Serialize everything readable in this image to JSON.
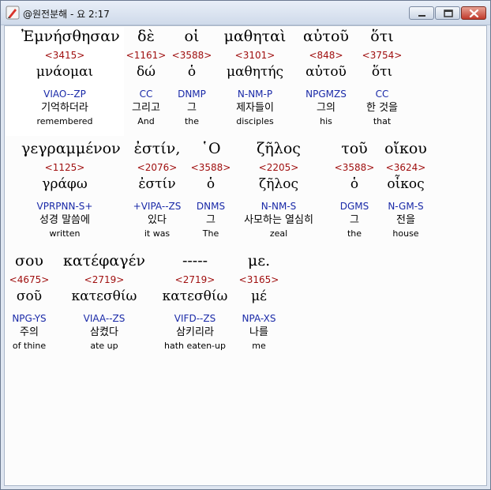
{
  "window": {
    "title": "@원전분해 - 요 2:17"
  },
  "words": [
    {
      "greek": "Ἐμνήσθησαν",
      "strong": "<3415>",
      "lemma": "μνάομαι",
      "morph": "VIAO--ZP",
      "korean": "기억하더라",
      "english": "remembered"
    },
    {
      "greek": "δὲ",
      "strong": "<1161>",
      "lemma": "δώ",
      "morph": "CC",
      "korean": "그리고",
      "english": "And"
    },
    {
      "greek": "οἱ",
      "strong": "<3588>",
      "lemma": "ὁ",
      "morph": "DNMP",
      "korean": "그",
      "english": "the"
    },
    {
      "greek": "μαθηταὶ",
      "strong": "<3101>",
      "lemma": "μαθητής",
      "morph": "N-NM-P",
      "korean": "제자들이",
      "english": "disciples"
    },
    {
      "greek": "αὐτοῦ",
      "strong": "<848>",
      "lemma": "αὐτοῦ",
      "morph": "NPGMZS",
      "korean": "그의",
      "english": "his"
    },
    {
      "greek": "ὅτι",
      "strong": "<3754>",
      "lemma": "ὅτι",
      "morph": "CC",
      "korean": "한 것을",
      "english": "that"
    },
    {
      "greek": "γεγραμμένον",
      "strong": "<1125>",
      "lemma": "γράφω",
      "morph": "VPRPNN-S+",
      "korean": "성경 말씀에",
      "english": "written"
    },
    {
      "greek": "ἐστίν,",
      "strong": "<2076>",
      "lemma": "ἐστίν",
      "morph": "+VIPA--ZS",
      "korean": "있다",
      "english": "it was"
    },
    {
      "greek": "῾Ο",
      "strong": "<3588>",
      "lemma": "ὁ",
      "morph": "DNMS",
      "korean": "그",
      "english": "The"
    },
    {
      "greek": "ζῆλος",
      "strong": "<2205>",
      "lemma": "ζῆλος",
      "morph": "N-NM-S",
      "korean": "사모하는 열심히",
      "english": "zeal"
    },
    {
      "greek": "τοῦ",
      "strong": "<3588>",
      "lemma": "ὁ",
      "morph": "DGMS",
      "korean": "그",
      "english": "the"
    },
    {
      "greek": "οἴκου",
      "strong": "<3624>",
      "lemma": "οἶκος",
      "morph": "N-GM-S",
      "korean": "전을",
      "english": "house"
    },
    {
      "greek": "σου",
      "strong": "<4675>",
      "lemma": "σοῦ",
      "morph": "NPG-YS",
      "korean": "주의",
      "english": "of thine"
    },
    {
      "greek": "κατέφαγέν",
      "strong": "<2719>",
      "lemma": "κατεσθίω",
      "morph": "VIAA--ZS",
      "korean": "삼켰다",
      "english": "ate up"
    },
    {
      "greek": "-----",
      "strong": "<2719>",
      "lemma": "κατεσθίω",
      "morph": "VIFD--ZS",
      "korean": "삼키리라",
      "english": "hath eaten-up"
    },
    {
      "greek": "με.",
      "strong": "<3165>",
      "lemma": "μέ",
      "morph": "NPA-XS",
      "korean": "나를",
      "english": "me"
    }
  ]
}
